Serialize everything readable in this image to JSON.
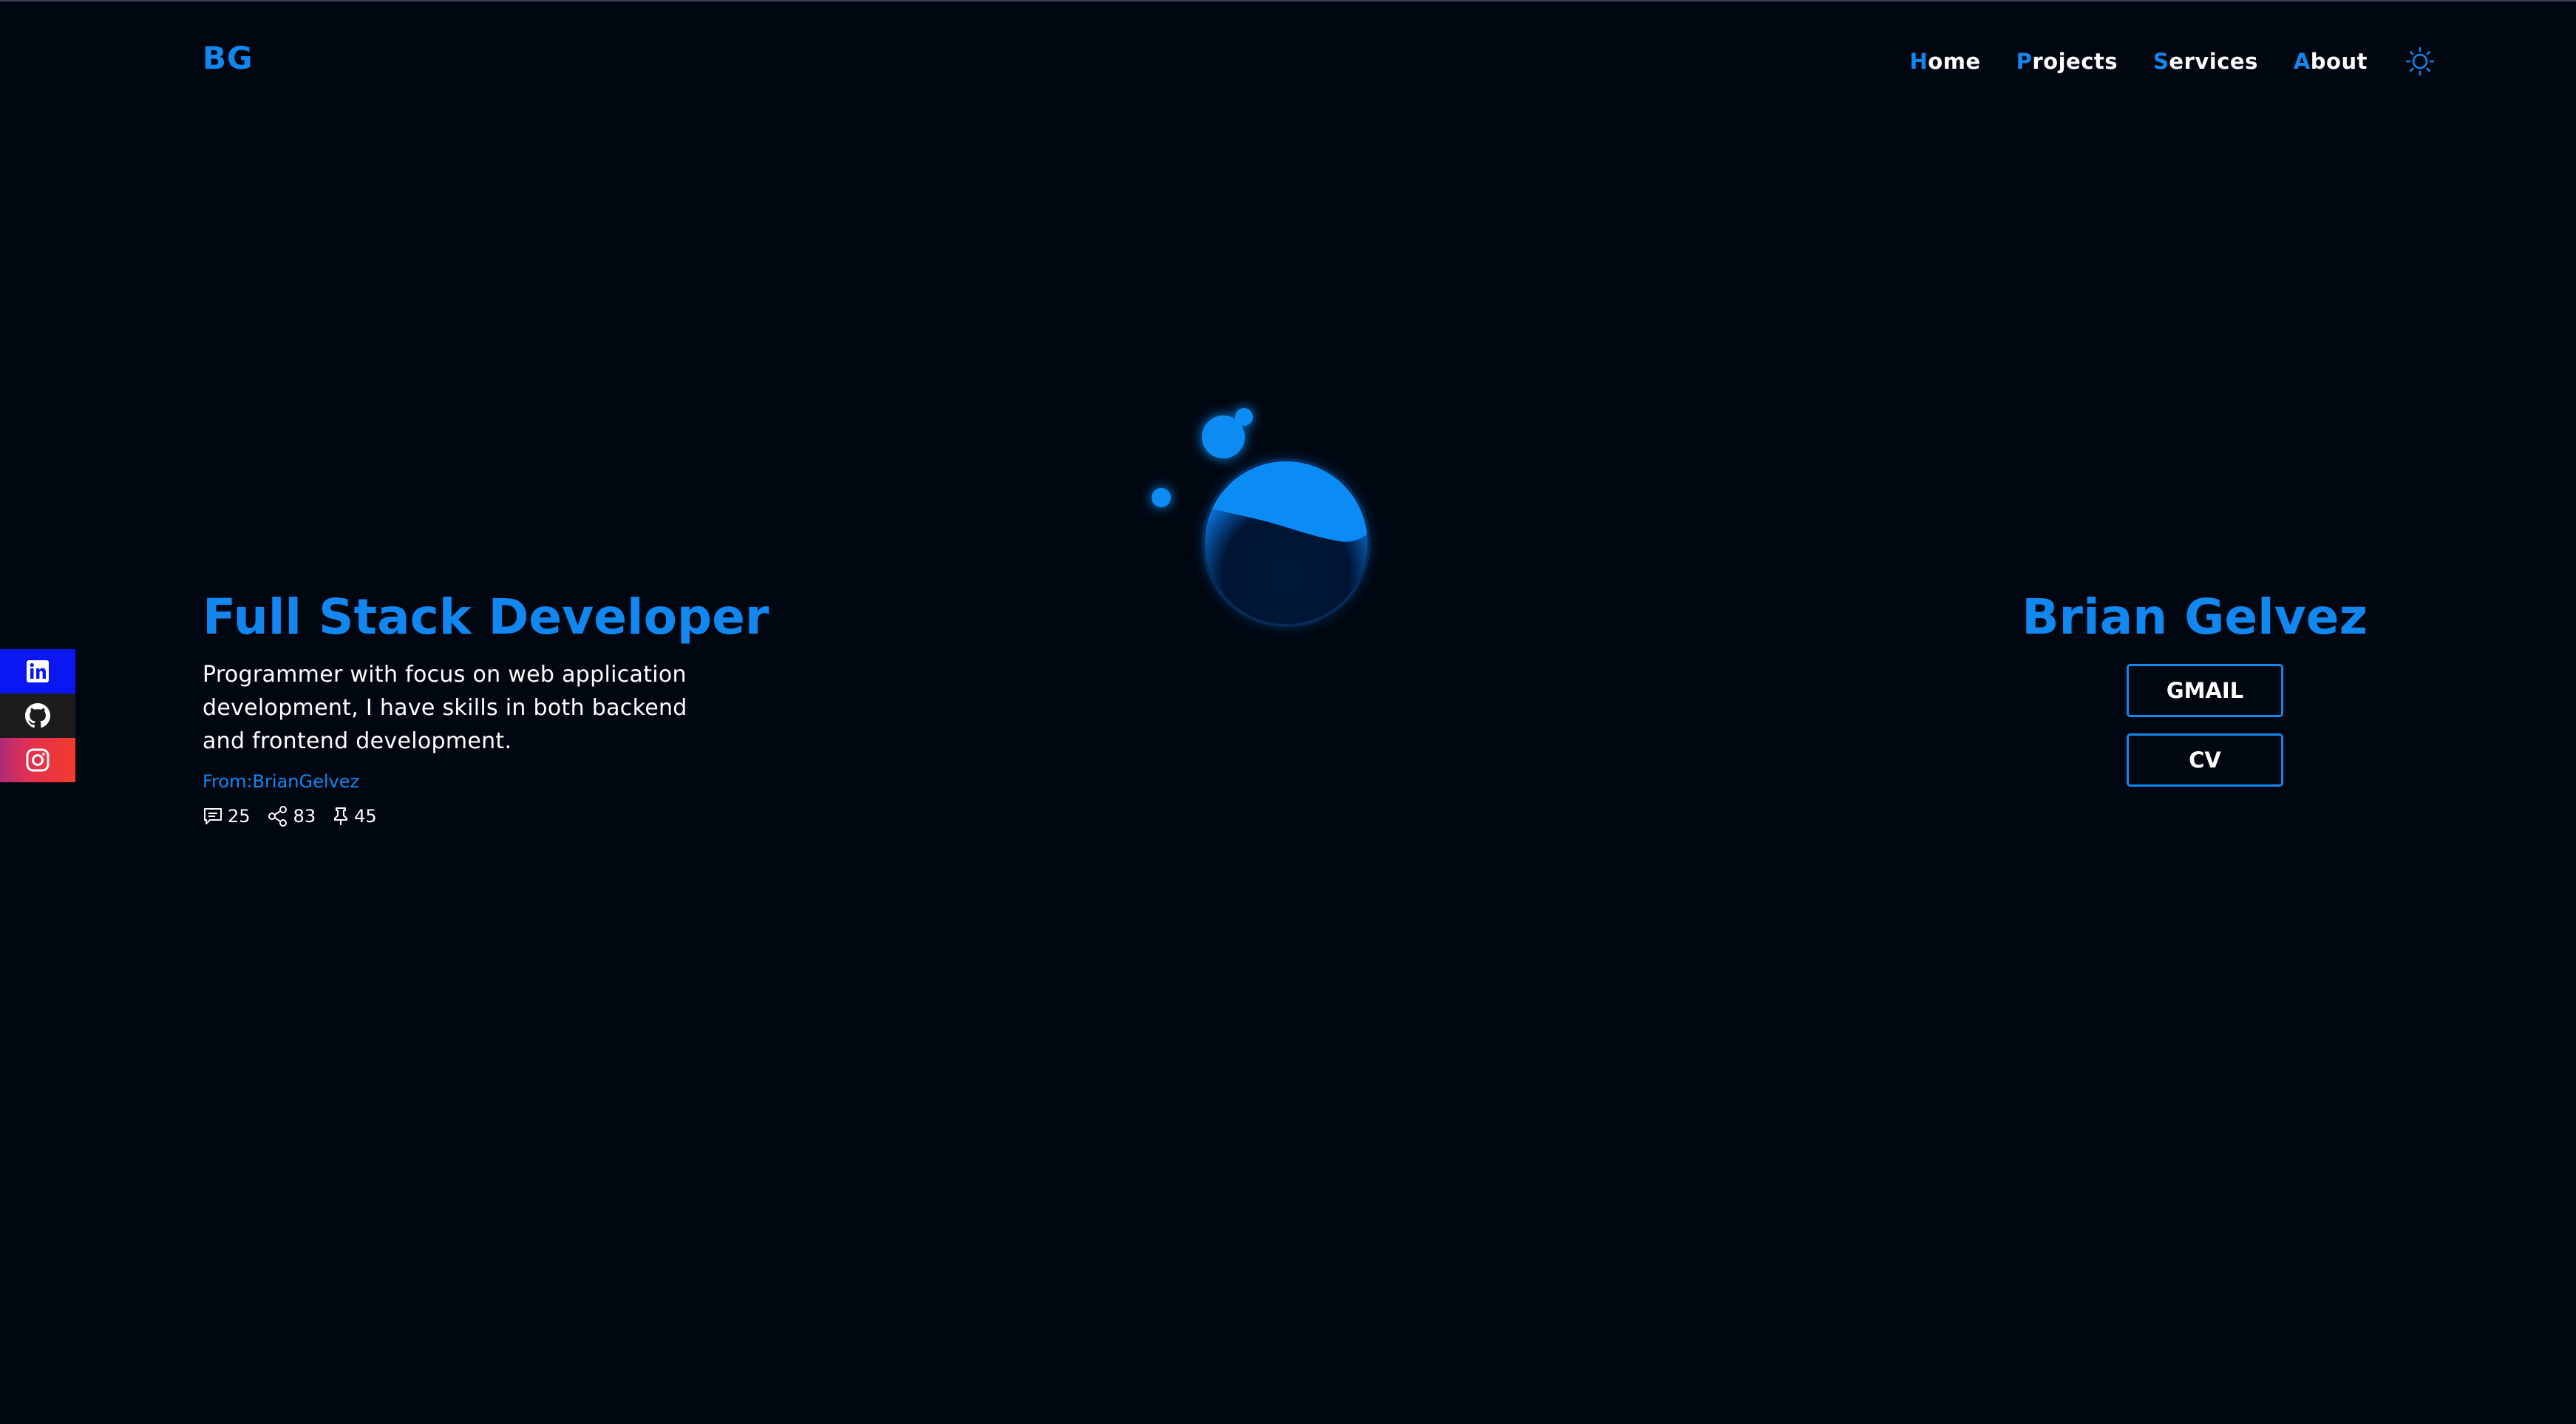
{
  "header": {
    "logo": "BG",
    "nav": [
      {
        "first": "H",
        "rest": "ome"
      },
      {
        "first": "P",
        "rest": "rojects"
      },
      {
        "first": "S",
        "rest": "ervices"
      },
      {
        "first": "A",
        "rest": "bout"
      }
    ],
    "theme_icon": "sun-icon"
  },
  "social": [
    {
      "icon": "linkedin-icon"
    },
    {
      "icon": "github-icon"
    },
    {
      "icon": "instagram-icon"
    }
  ],
  "hero": {
    "title": "Full Stack Developer",
    "description_lines": [
      "Programmer with focus on web application",
      "development, I have skills in both backend",
      "and frontend development."
    ],
    "from": "From:BrianGelvez",
    "stats": {
      "comments": "25",
      "shares": "83",
      "pins": "45"
    }
  },
  "profile": {
    "name": "Brian Gelvez",
    "gmail_label": "GMAIL",
    "cv_label": "CV"
  },
  "colors": {
    "background": "#010711",
    "accent": "#1287f0",
    "text": "#ffffff"
  }
}
